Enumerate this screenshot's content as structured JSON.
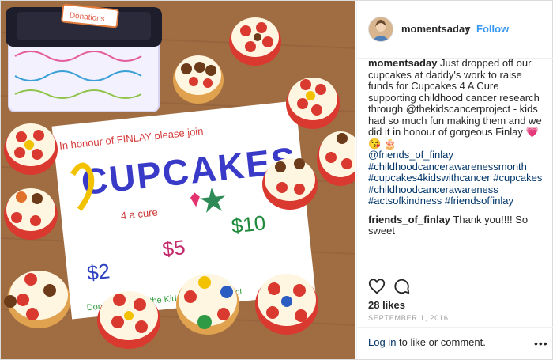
{
  "post": {
    "username": "momentsaday",
    "separator": "•",
    "follow_label": "Follow",
    "caption_user": "momentsaday",
    "caption_text": "Just dropped off our cupcakes at daddy's work to raise funds for Cupcakes 4 A Cure supporting childhood cancer research through @thekidscancerproject - kids had so much fun making them and we did it in honour of gorgeous Finlay 💗 😘 🎂",
    "hashtags": [
      "@friends_of_finlay",
      "#childhoodcancerawarenessmonth",
      "#cupcakes4kidswithcancer #cupcakes",
      "#childhoodcancerawareness",
      "#actsofkindness #friendsoffinlay"
    ],
    "comments": [
      {
        "user": "friends_of_finlay",
        "text": "Thank you!!!! So sweet"
      }
    ],
    "likes_label": "28 likes",
    "date": "SEPTEMBER 1, 2016",
    "login_link": "Log in",
    "login_rest": " to like or comment.",
    "more_label": "•••"
  },
  "photo": {
    "box_label": "Donations",
    "sign_line1": "In honour of FINLAY please join",
    "sign_title": "CUPCAKES",
    "sign_subtitle": "4 a cure",
    "price_2": "$2",
    "price_5": "$5",
    "price_10": "$10",
    "sign_footer": "Donations go to the Kids' Cancer Project"
  },
  "colors": {
    "accent": "#3897f0",
    "link": "#003569",
    "text": "#262626",
    "muted": "#999999",
    "border": "#dbdbdb"
  }
}
